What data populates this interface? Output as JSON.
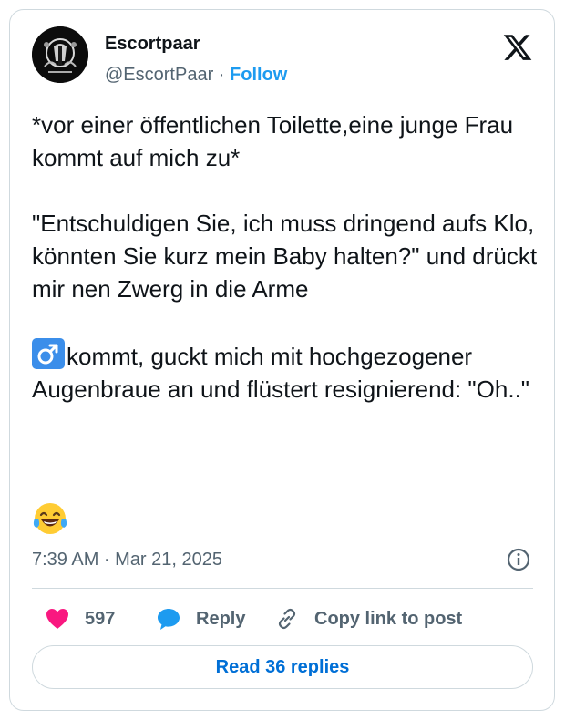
{
  "author": {
    "display_name": "Escortpaar",
    "handle": "@EscortPaar",
    "separator": " · ",
    "follow_label": "Follow"
  },
  "tweet": {
    "line1": "*vor einer öffentlichen Toilette,eine junge Frau kommt auf mich zu*",
    "line2": "\"Entschuldigen Sie, ich muss dringend aufs Klo, könnten Sie kurz mein Baby halten?\" und drückt mir nen Zwerg in die Arme",
    "line3": "kommt, guckt mich mit hochgezogener Augenbraue an und flüstert resignierend: \"Oh..\"",
    "emoji": "face-with-tears-of-joy"
  },
  "timestamp": "7:39 AM · Mar 21, 2025",
  "actions": {
    "likes": "597",
    "reply_label": "Reply",
    "copy_link_label": "Copy link to post"
  },
  "read_replies_label": "Read 36 replies",
  "colors": {
    "accent": "#1d9bf0",
    "heart": "#f91880",
    "reply_bubble": "#1d9bf0",
    "badge": "#3b8eea",
    "muted": "#536471"
  },
  "icons": [
    "x-logo-icon",
    "info-icon",
    "heart-icon",
    "reply-icon",
    "link-icon",
    "male-sign-icon"
  ]
}
